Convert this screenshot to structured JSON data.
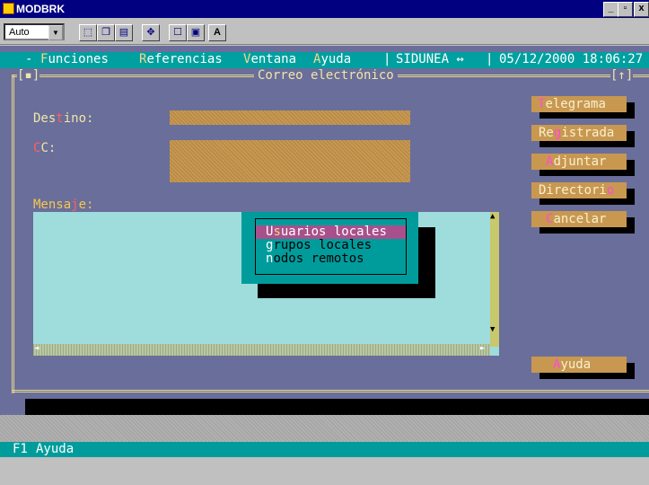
{
  "window": {
    "title": "MODBRK",
    "minimize": "_",
    "maximize": "▫",
    "close": "x"
  },
  "toolbar": {
    "font_value": "Auto",
    "font_arrow": "▼",
    "icons": [
      "select-icon",
      "copy-icon",
      "paste-icon",
      "fullscreen-icon",
      "properties-icon",
      "background-icon",
      "font-icon"
    ],
    "font_button": "A"
  },
  "menu": {
    "dash": "-",
    "funciones": {
      "hot": "F",
      "rest": "unciones"
    },
    "referencias": {
      "hot": "R",
      "rest": "eferencias"
    },
    "ventana": {
      "hot": "V",
      "rest": "entana"
    },
    "ayuda": {
      "hot": "A",
      "rest": "yuda"
    },
    "separator": "|",
    "system": "SIDUNEA ↔",
    "separator2": "|",
    "datetime": "05/12/2000 18:06:27"
  },
  "dialog": {
    "close_marker": "[▪]",
    "title": "Correo electrónico",
    "zoom_marker": "[↑]",
    "destino": {
      "pre": "Des",
      "hot": "t",
      "post": "ino:"
    },
    "cc": {
      "hot": "C",
      "post": "C:"
    },
    "mensaje": {
      "pre": "Mensa",
      "hot": "j",
      "post": "e:"
    }
  },
  "buttons": {
    "telegrama": {
      "hot": "T",
      "rest": "elegrama"
    },
    "registrada": {
      "pre": "Re",
      "hot": "g",
      "rest": "istrada"
    },
    "adjuntar": {
      "hot": "A",
      "rest": "djuntar"
    },
    "directorio": {
      "pre": "Directori",
      "hot": "o",
      "rest": ""
    },
    "cancelar": {
      "hot": "C",
      "rest": "ancelar"
    },
    "ayuda": {
      "hot": "A",
      "rest": "yuda"
    }
  },
  "popup": {
    "items": [
      {
        "pre": "U",
        "hot": "s",
        "rest": "uarios locales"
      },
      {
        "pre": "",
        "hot": "g",
        "rest": "rupos locales"
      },
      {
        "pre": "",
        "hot": "n",
        "rest": "odos remotos"
      }
    ]
  },
  "scroll": {
    "up": "▲",
    "down": "▼",
    "left": "◄",
    "right": "►"
  },
  "status": {
    "key": "F1",
    "label": "Ayuda"
  },
  "colors": {
    "screen": "#6a6e9a",
    "menubar": "#00a0a0",
    "field": "#c89850",
    "message": "#9fdcdc",
    "hotkey": "#ff4cd2"
  }
}
